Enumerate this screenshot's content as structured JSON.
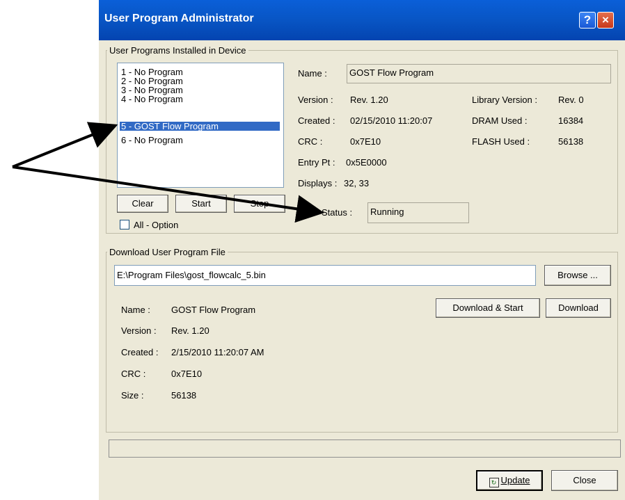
{
  "window": {
    "title": "User Program Administrator",
    "help_glyph": "?",
    "close_glyph": "×"
  },
  "installed": {
    "group_label": "User Programs Installed in Device",
    "programs": [
      "1 - No Program",
      "2 - No Program",
      "3 - No Program",
      "4 - No Program",
      "5 - GOST Flow Program",
      "6 - No Program"
    ],
    "selected_index": 4,
    "buttons": {
      "clear": "Clear",
      "start": "Start",
      "stop": "Stop"
    },
    "all_option_label": "All - Option",
    "all_option_checked": false,
    "details": {
      "name_label": "Name :",
      "name_value": "GOST Flow Program",
      "version_label": "Version :",
      "version_value": "Rev. 1.20",
      "created_label": "Created :",
      "created_value": "02/15/2010 11:20:07",
      "crc_label": "CRC :",
      "crc_value": "0x7E10",
      "entry_label": "Entry Pt :",
      "entry_value": "0x5E0000",
      "displays_label": "Displays :",
      "displays_value": "32, 33",
      "library_label": "Library Version :",
      "library_value": "Rev. 0",
      "dram_label": "DRAM Used :",
      "dram_value": "16384",
      "flash_label": "FLASH Used :",
      "flash_value": "56138",
      "status_label": "Status :",
      "status_value": "Running"
    }
  },
  "download": {
    "group_label": "Download User Program File",
    "file_path": "E:\\Program Files\\gost_flowcalc_5.bin",
    "browse_label": "Browse ...",
    "download_start_label": "Download & Start",
    "download_label": "Download",
    "name_label": "Name :",
    "name_value": "GOST Flow Program",
    "version_label": "Version :",
    "version_value": "Rev. 1.20",
    "created_label": "Created :",
    "created_value": "2/15/2010 11:20:07 AM",
    "crc_label": "CRC :",
    "crc_value": "0x7E10",
    "size_label": "Size :",
    "size_value": "56138"
  },
  "footer": {
    "update_label": "Update",
    "close_label": "Close",
    "progress_fraction": 0
  },
  "colors": {
    "title_bar": "#0855c4",
    "selection": "#316ac5",
    "dialog_bg": "#ece9d8"
  }
}
